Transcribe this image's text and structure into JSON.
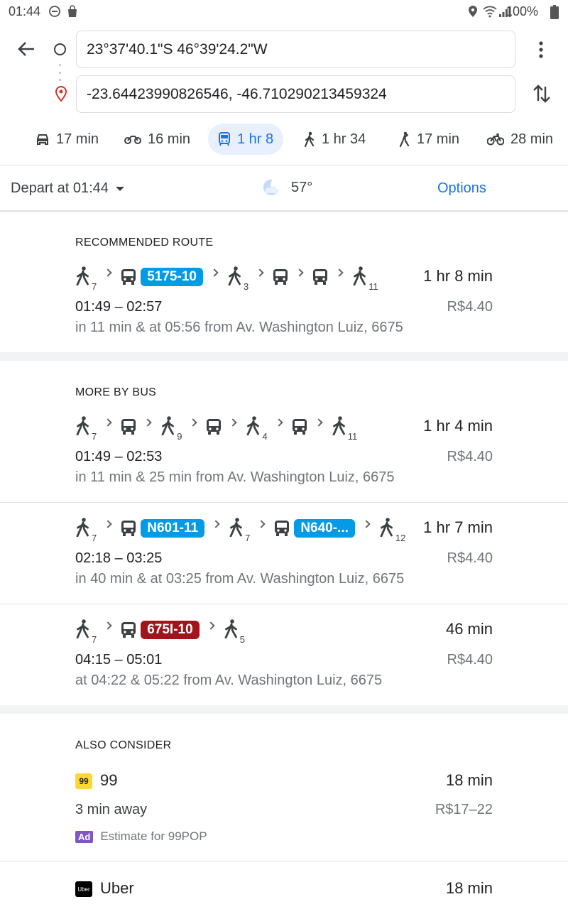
{
  "status_bar": {
    "time": "01:44",
    "battery": "100%"
  },
  "directions": {
    "from": "23°37'40.1\"S 46°39'24.2\"W",
    "to": "-23.64423990826546, -46.710290213459324"
  },
  "modes": [
    {
      "icon": "car-icon",
      "label": "17 min"
    },
    {
      "icon": "motorcycle-icon",
      "label": "16 min"
    },
    {
      "icon": "transit-icon",
      "label": "1 hr 8",
      "active": true
    },
    {
      "icon": "walk-icon",
      "label": "1 hr 34"
    },
    {
      "icon": "ride-hail-icon",
      "label": "17 min"
    },
    {
      "icon": "bike-icon",
      "label": "28 min"
    }
  ],
  "depart": {
    "label": "Depart at 01:44",
    "weather_temp": "57°",
    "options_label": "Options"
  },
  "recommended": {
    "title": "RECOMMENDED ROUTE",
    "route": {
      "steps": [
        {
          "type": "walk",
          "sub": "7"
        },
        {
          "type": "bus",
          "badge": "5175-10",
          "badge_color": "#039be5"
        },
        {
          "type": "walk",
          "sub": "3"
        },
        {
          "type": "bus"
        },
        {
          "type": "bus"
        },
        {
          "type": "walk",
          "sub": "11"
        }
      ],
      "duration": "1 hr 8 min",
      "times": "01:49 – 02:57",
      "fare": "R$4.40",
      "note": "in 11 min & at 05:56 from Av. Washington Luiz, 6675"
    }
  },
  "more_by_bus": {
    "title": "MORE BY BUS",
    "routes": [
      {
        "steps": [
          {
            "type": "walk",
            "sub": "7"
          },
          {
            "type": "bus"
          },
          {
            "type": "walk",
            "sub": "9"
          },
          {
            "type": "bus"
          },
          {
            "type": "walk",
            "sub": "4"
          },
          {
            "type": "bus"
          },
          {
            "type": "walk",
            "sub": "11"
          }
        ],
        "duration": "1 hr 4 min",
        "times": "01:49 – 02:53",
        "fare": "R$4.40",
        "note": "in 11 min & 25 min from Av. Washington Luiz, 6675"
      },
      {
        "steps": [
          {
            "type": "walk",
            "sub": "7"
          },
          {
            "type": "bus",
            "badge": "N601-11",
            "badge_color": "#039be5"
          },
          {
            "type": "walk",
            "sub": "7"
          },
          {
            "type": "bus",
            "badge": "N640-...",
            "badge_color": "#039be5"
          },
          {
            "type": "walk",
            "sub": "12"
          }
        ],
        "duration": "1 hr 7 min",
        "times": "02:18 – 03:25",
        "fare": "R$4.40",
        "note": "in 40 min & at 03:25 from Av. Washington Luiz, 6675"
      },
      {
        "steps": [
          {
            "type": "walk",
            "sub": "7"
          },
          {
            "type": "bus",
            "badge": "675I-10",
            "badge_color": "#a3141a"
          },
          {
            "type": "walk",
            "sub": "5"
          }
        ],
        "duration": "46 min",
        "times": "04:15 – 05:01",
        "fare": "R$4.40",
        "note": "at 04:22 & 05:22 from Av. Washington Luiz, 6675"
      }
    ]
  },
  "also_consider": {
    "title": "ALSO CONSIDER",
    "items": [
      {
        "logo_text": "99",
        "name": "99",
        "duration": "18 min",
        "away": "3 min away",
        "price": "R$17–22",
        "ad_badge": "Ad",
        "ad_text": "Estimate for 99POP"
      },
      {
        "logo_text": "Uber",
        "name": "Uber",
        "duration": "18 min"
      }
    ]
  },
  "colors": {
    "accent": "#1a73e8",
    "transit_blue": "#039be5",
    "transit_red": "#a3141a",
    "ad_purple": "#7e57c2"
  }
}
